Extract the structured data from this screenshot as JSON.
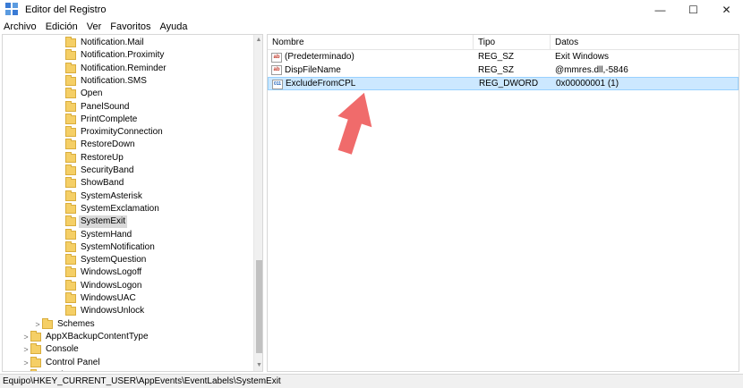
{
  "window": {
    "title": "Editor del Registro",
    "controls": {
      "minimize": "—",
      "maximize": "☐",
      "close": "✕"
    }
  },
  "menu": [
    "Archivo",
    "Edición",
    "Ver",
    "Favoritos",
    "Ayuda"
  ],
  "tree": {
    "items": [
      {
        "label": "Notification.Mail"
      },
      {
        "label": "Notification.Proximity"
      },
      {
        "label": "Notification.Reminder"
      },
      {
        "label": "Notification.SMS"
      },
      {
        "label": "Open"
      },
      {
        "label": "PanelSound"
      },
      {
        "label": "PrintComplete"
      },
      {
        "label": "ProximityConnection"
      },
      {
        "label": "RestoreDown"
      },
      {
        "label": "RestoreUp"
      },
      {
        "label": "SecurityBand"
      },
      {
        "label": "ShowBand"
      },
      {
        "label": "SystemAsterisk"
      },
      {
        "label": "SystemExclamation"
      },
      {
        "label": "SystemExit",
        "selected": true
      },
      {
        "label": "SystemHand"
      },
      {
        "label": "SystemNotification"
      },
      {
        "label": "SystemQuestion"
      },
      {
        "label": "WindowsLogoff"
      },
      {
        "label": "WindowsLogon"
      },
      {
        "label": "WindowsUAC"
      },
      {
        "label": "WindowsUnlock"
      },
      {
        "label": "Schemes",
        "expander": ">"
      },
      {
        "label": "AppXBackupContentType",
        "expander": ">"
      },
      {
        "label": "Console",
        "expander": ">"
      },
      {
        "label": "Control Panel",
        "expander": ">"
      },
      {
        "label": "Environment"
      }
    ]
  },
  "values": {
    "columns": {
      "name": "Nombre",
      "type": "Tipo",
      "data": "Datos"
    },
    "rows": [
      {
        "icon": "ab",
        "name": "(Predeterminado)",
        "type": "REG_SZ",
        "data": "Exit Windows"
      },
      {
        "icon": "ab",
        "name": "DispFileName",
        "type": "REG_SZ",
        "data": "@mmres.dll,-5846"
      },
      {
        "icon": "dword",
        "name": "ExcludeFromCPL",
        "type": "REG_DWORD",
        "data": "0x00000001 (1)",
        "selected": true
      }
    ]
  },
  "annotation": {
    "arrow_color": "#f06b6b"
  },
  "status": {
    "path": "Equipo\\HKEY_CURRENT_USER\\AppEvents\\EventLabels\\SystemExit"
  }
}
